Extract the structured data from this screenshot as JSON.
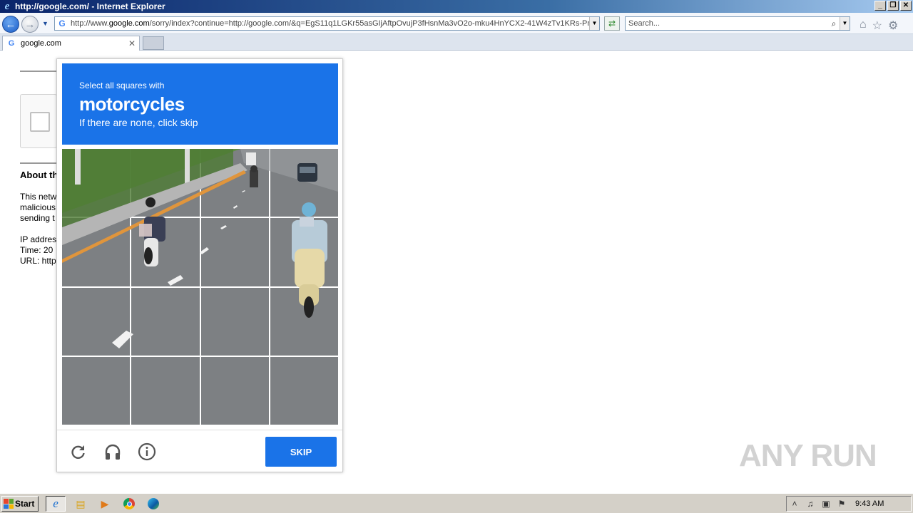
{
  "window": {
    "title": "http://google.com/ - Internet Explorer",
    "controls": [
      "_",
      "❐",
      "✕"
    ]
  },
  "navbar": {
    "address_prefix": "http://www.",
    "address_domain": "google.com",
    "address_rest": "/sorry/index?continue=http://google.com/&q=EgS11q1LGKr55asGIjAftpOvujP3fHsnMa3vO2o-mku4HnYCX2-41W4zTv1KRs-PnI",
    "search_placeholder": "Search..."
  },
  "tabs": [
    {
      "label": "google.com"
    }
  ],
  "page": {
    "about_heading": "About th",
    "para_lines": [
      "This netw",
      "malicious",
      "sending t"
    ],
    "info_lines": [
      "IP addres",
      "Time: 20",
      "URL: http"
    ]
  },
  "captcha": {
    "instruction": "Select all squares with",
    "target": "motorcycles",
    "hint": "If there are none, click skip",
    "skip_label": "SKIP",
    "grid_size": 4
  },
  "watermark": "ANY RUN",
  "taskbar": {
    "start_label": "Start",
    "clock": "9:43 AM",
    "apps": [
      "internet-explorer",
      "file-explorer",
      "media-player",
      "chrome",
      "edge"
    ]
  },
  "colors": {
    "accent": "#1a73e8",
    "titlebar": "#0a246a",
    "road": "#7d8083"
  }
}
